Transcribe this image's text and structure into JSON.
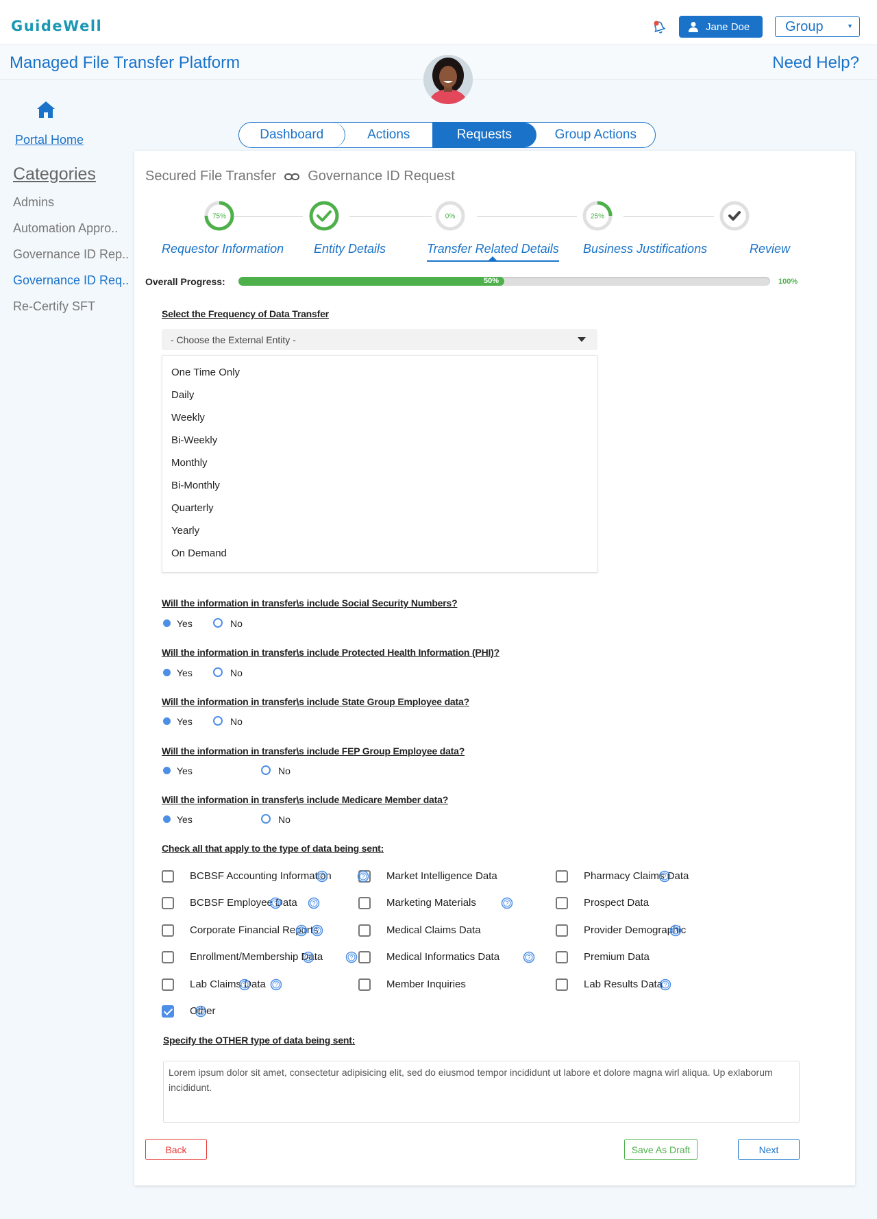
{
  "header": {
    "logo_text": "GuideWell",
    "user_name": "Jane Doe",
    "group_label": "Group",
    "app_title": "Managed File Transfer Platform",
    "help_label": "Need Help?"
  },
  "sidebar": {
    "home_label": "Portal Home",
    "categories_title": "Categories",
    "items": [
      {
        "label": "Admins"
      },
      {
        "label": "Automation Appro.."
      },
      {
        "label": "Governance ID Rep.."
      },
      {
        "label": "Governance ID Req.."
      },
      {
        "label": "Re-Certify SFT"
      }
    ],
    "active_item": "Governance ID Req.."
  },
  "tabs": [
    {
      "label": "Dashboard"
    },
    {
      "label": "Actions"
    },
    {
      "label": "Requests"
    },
    {
      "label": "Group Actions"
    }
  ],
  "active_tab": "Requests",
  "breadcrumb": {
    "first": "Secured File Transfer",
    "second": "Governance ID Request"
  },
  "steps": [
    {
      "label": "Requestor Information",
      "percent": 75,
      "percent_text": "75%",
      "state": "partial"
    },
    {
      "label": "Entity Details",
      "percent": 100,
      "state": "complete"
    },
    {
      "label": "Transfer Related Details",
      "percent": 0,
      "percent_text": "0%",
      "state": "current"
    },
    {
      "label": "Business Justifications",
      "percent": 25,
      "percent_text": "25%",
      "state": "partial"
    },
    {
      "label": "Review",
      "percent": 0,
      "state": "review"
    }
  ],
  "progress": {
    "label": "Overall Progress:",
    "value": 50,
    "value_text": "50%",
    "max_text": "100%"
  },
  "frequency": {
    "question": "Select the Frequency of Data Transfer",
    "placeholder": "- Choose the External Entity -",
    "options": [
      "One Time Only",
      "Daily",
      "Weekly",
      "Bi-Weekly",
      "Monthly",
      "Bi-Monthly",
      "Quarterly",
      "Yearly",
      "On Demand"
    ]
  },
  "questions": [
    {
      "text": "Will the information in transfer\\s include Social Security Numbers?",
      "yes": "Yes",
      "no": "No",
      "selected": "Yes"
    },
    {
      "text": "Will the information in transfer\\s include Protected Health Information (PHI)?",
      "yes": "Yes",
      "no": "No",
      "selected": "Yes"
    },
    {
      "text": "Will the information in transfer\\s include State Group Employee data?",
      "yes": "Yes",
      "no": "No",
      "selected": "Yes"
    },
    {
      "text": "Will the information in transfer\\s include FEP Group Employee data?",
      "yes": "Yes",
      "no": "No",
      "selected": "Yes"
    },
    {
      "text": "Will the information in transfer\\s include Medicare Member data?",
      "yes": "Yes",
      "no": "No",
      "selected": "Yes"
    }
  ],
  "data_types": {
    "question": "Check all that apply to the type of data being sent:",
    "items": [
      {
        "label": "BCBSF Accounting Information",
        "checked": false
      },
      {
        "label": "Market Intelligence Data",
        "checked": false
      },
      {
        "label": "Pharmacy Claims Data",
        "checked": false
      },
      {
        "label": "BCBSF Employee Data",
        "checked": false
      },
      {
        "label": "Marketing Materials",
        "checked": false
      },
      {
        "label": "Prospect Data",
        "checked": false
      },
      {
        "label": "Corporate Financial Reports",
        "checked": false
      },
      {
        "label": "Medical Claims Data",
        "checked": false
      },
      {
        "label": "Provider Demographic",
        "checked": false
      },
      {
        "label": "Enrollment/Membership Data",
        "checked": false
      },
      {
        "label": "Medical Informatics Data",
        "checked": false
      },
      {
        "label": "Premium Data",
        "checked": false
      },
      {
        "label": "Lab Claims Data",
        "checked": false
      },
      {
        "label": "Member Inquiries",
        "checked": false
      },
      {
        "label": "Lab Results Data",
        "checked": false
      },
      {
        "label": "Other",
        "checked": true
      }
    ]
  },
  "other": {
    "question": "Specify the OTHER type of data being sent:",
    "value": "Lorem ipsum dolor sit amet, consectetur adipisicing elit, sed do eiusmod tempor incididunt ut labore et dolore magna wirl aliqua. Up exlaborum incididunt."
  },
  "buttons": {
    "back": "Back",
    "draft": "Save As Draft",
    "next": "Next"
  },
  "colors": {
    "brand": "#1a73c9",
    "logo": "#1a98b3",
    "success": "#4db04a",
    "danger": "#e53935",
    "radio": "#4d8fe6"
  }
}
